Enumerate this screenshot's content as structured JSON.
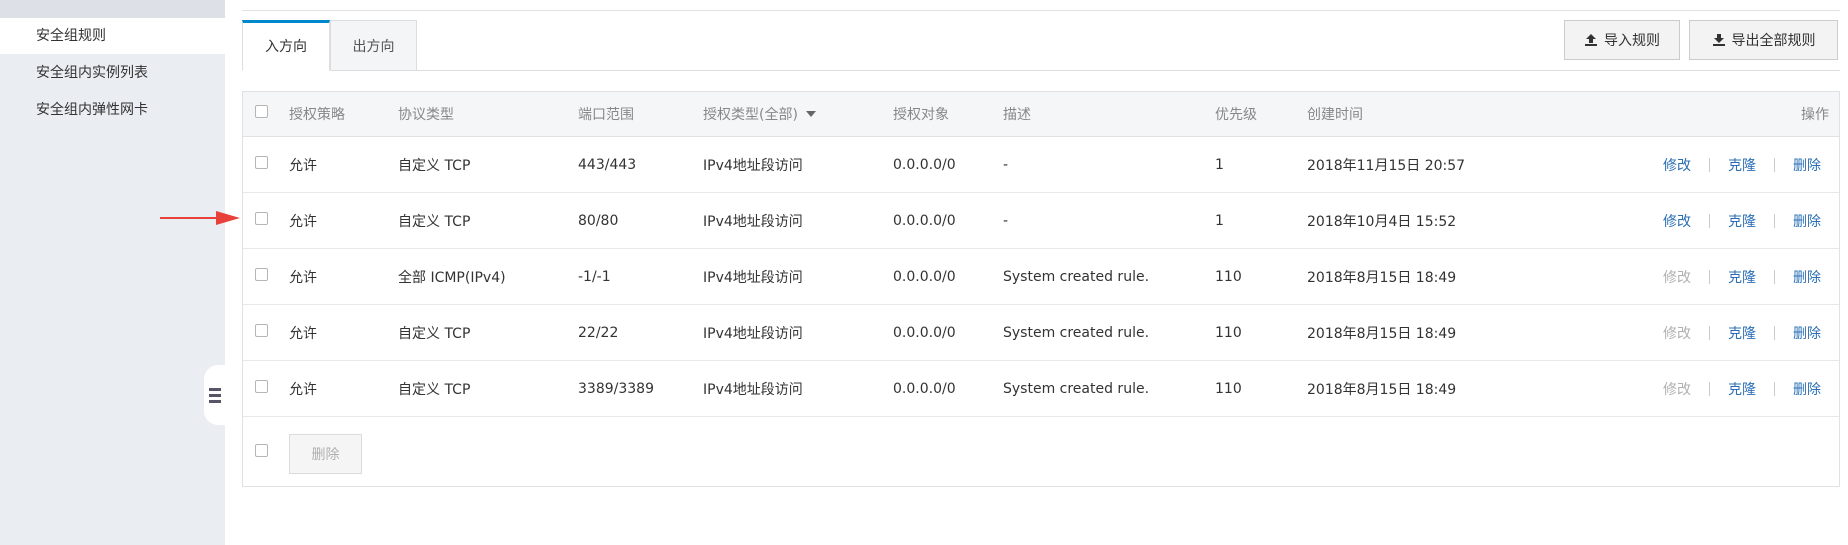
{
  "sidebar": {
    "items": [
      {
        "label": "安全组规则",
        "active": true
      },
      {
        "label": "安全组内实例列表",
        "active": false
      },
      {
        "label": "安全组内弹性网卡",
        "active": false
      }
    ]
  },
  "tabs": [
    {
      "label": "入方向",
      "active": true
    },
    {
      "label": "出方向",
      "active": false
    }
  ],
  "toolbar": {
    "import_label": "导入规则",
    "export_label": "导出全部规则"
  },
  "table": {
    "headers": {
      "policy": "授权策略",
      "protocol": "协议类型",
      "port": "端口范围",
      "auth_type": "授权类型(全部)",
      "auth_object": "授权对象",
      "description": "描述",
      "priority": "优先级",
      "created": "创建时间",
      "actions": "操作"
    },
    "rows": [
      {
        "policy": "允许",
        "protocol": "自定义 TCP",
        "port": "443/443",
        "auth_type": "IPv4地址段访问",
        "auth_object": "0.0.0.0/0",
        "description": "-",
        "priority": "1",
        "created": "2018年11月15日 20:57",
        "modify": "修改",
        "modify_enabled": true,
        "clone": "克隆",
        "delete": "删除"
      },
      {
        "policy": "允许",
        "protocol": "自定义 TCP",
        "port": "80/80",
        "auth_type": "IPv4地址段访问",
        "auth_object": "0.0.0.0/0",
        "description": "-",
        "priority": "1",
        "created": "2018年10月4日 15:52",
        "modify": "修改",
        "modify_enabled": true,
        "clone": "克隆",
        "delete": "删除"
      },
      {
        "policy": "允许",
        "protocol": "全部 ICMP(IPv4)",
        "port": "-1/-1",
        "auth_type": "IPv4地址段访问",
        "auth_object": "0.0.0.0/0",
        "description": "System created rule.",
        "priority": "110",
        "created": "2018年8月15日 18:49",
        "modify": "修改",
        "modify_enabled": false,
        "clone": "克隆",
        "delete": "删除"
      },
      {
        "policy": "允许",
        "protocol": "自定义 TCP",
        "port": "22/22",
        "auth_type": "IPv4地址段访问",
        "auth_object": "0.0.0.0/0",
        "description": "System created rule.",
        "priority": "110",
        "created": "2018年8月15日 18:49",
        "modify": "修改",
        "modify_enabled": false,
        "clone": "克隆",
        "delete": "删除"
      },
      {
        "policy": "允许",
        "protocol": "自定义 TCP",
        "port": "3389/3389",
        "auth_type": "IPv4地址段访问",
        "auth_object": "0.0.0.0/0",
        "description": "System created rule.",
        "priority": "110",
        "created": "2018年8月15日 18:49",
        "modify": "修改",
        "modify_enabled": false,
        "clone": "克隆",
        "delete": "删除"
      }
    ],
    "footer_delete_label": "删除"
  },
  "colors": {
    "accent": "#0088cc",
    "link": "#2a6fb5",
    "disabled": "#b0b0b0",
    "annotation_arrow": "#e8413a"
  }
}
